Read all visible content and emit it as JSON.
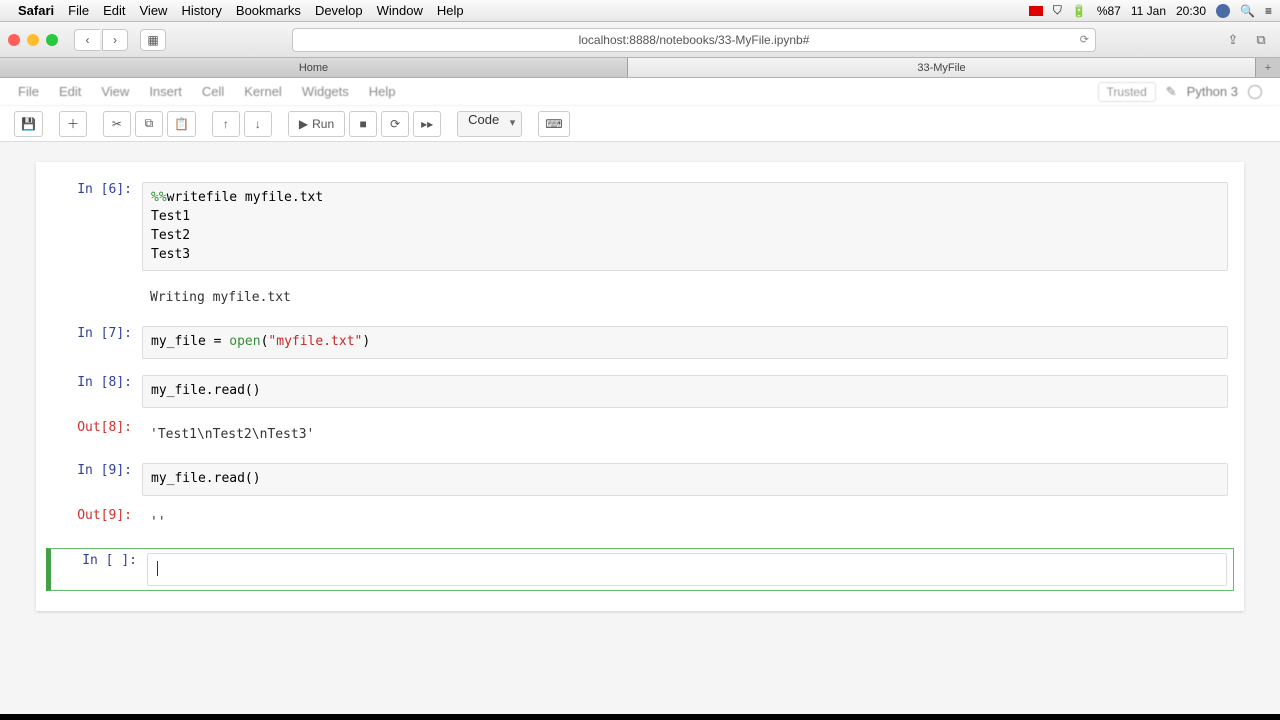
{
  "menubar": {
    "app": "Safari",
    "items": [
      "File",
      "Edit",
      "View",
      "History",
      "Bookmarks",
      "Develop",
      "Window",
      "Help"
    ],
    "battery": "%87",
    "date": "11 Jan",
    "time": "20:30"
  },
  "safari": {
    "url": "localhost:8888/notebooks/33-MyFile.ipynb#",
    "tabs": [
      "Home",
      "33-MyFile"
    ],
    "active_tab": 1
  },
  "jupyter_menu": {
    "items": [
      "File",
      "Edit",
      "View",
      "Insert",
      "Cell",
      "Kernel",
      "Widgets",
      "Help"
    ],
    "trusted": "Trusted",
    "kernel": "Python 3"
  },
  "toolbar": {
    "run_label": "Run",
    "celltype": "Code"
  },
  "cells": [
    {
      "in_prompt": "In [6]:",
      "code_magic": "%%",
      "code_rest": "writefile myfile.txt",
      "code_lines": [
        "Test1",
        "Test2",
        "Test3"
      ],
      "output": "Writing myfile.txt"
    },
    {
      "in_prompt": "In [7]:",
      "code_plain1": "my_file = ",
      "code_builtin": "open",
      "code_plain2": "(",
      "code_string": "\"myfile.txt\"",
      "code_plain3": ")"
    },
    {
      "in_prompt": "In [8]:",
      "code_plain": "my_file.read()",
      "out_prompt": "Out[8]:",
      "output": "'Test1\\nTest2\\nTest3'"
    },
    {
      "in_prompt": "In [9]:",
      "code_plain": "my_file.read()",
      "out_prompt": "Out[9]:",
      "output": "''"
    },
    {
      "in_prompt": "In [ ]:",
      "code_plain": ""
    }
  ]
}
